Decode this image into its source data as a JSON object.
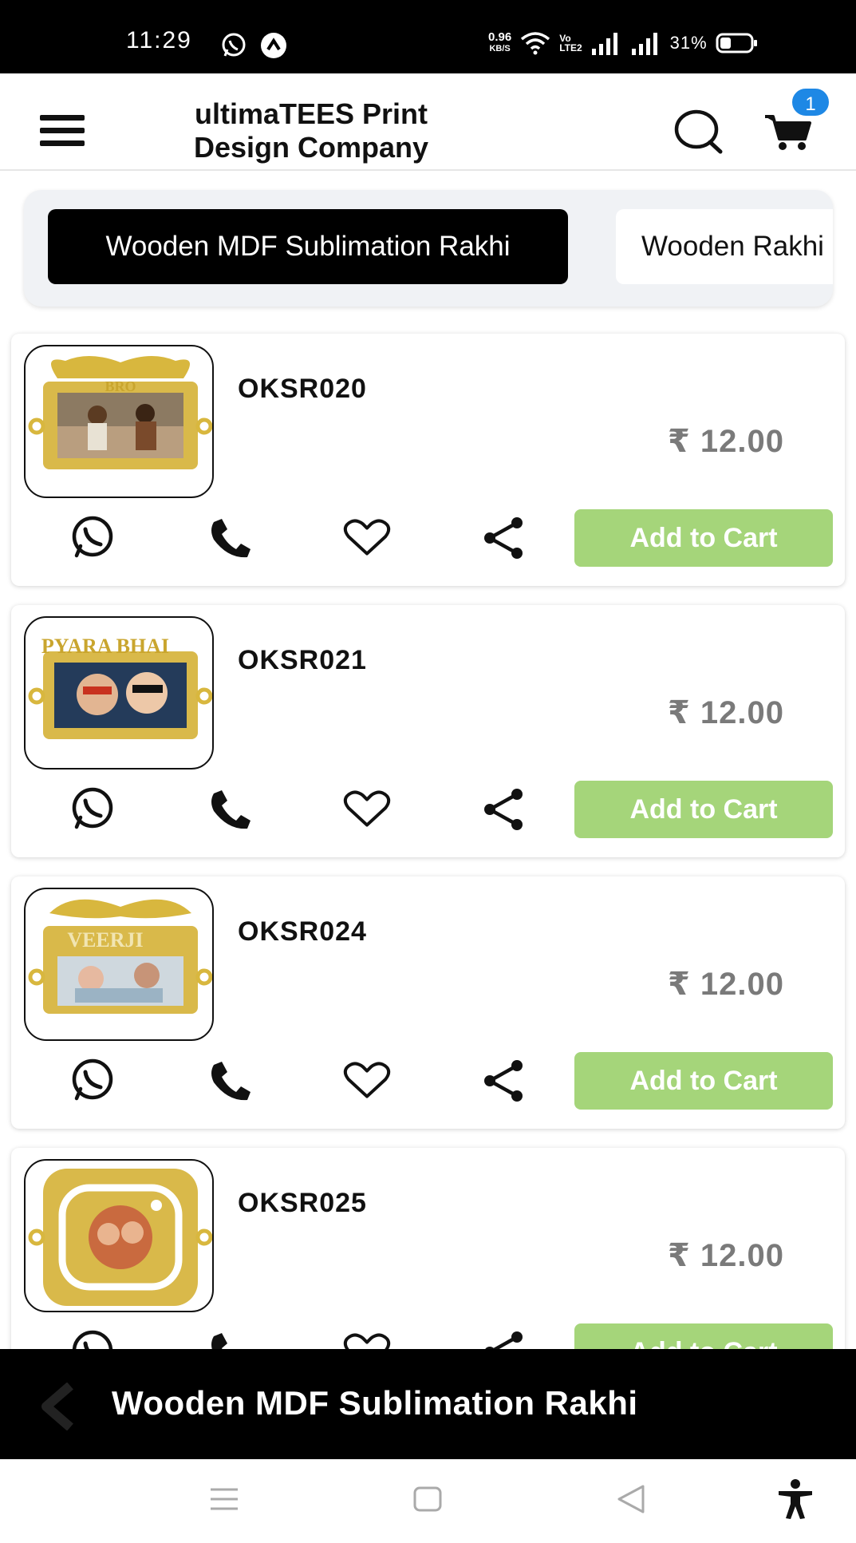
{
  "status_bar": {
    "time": "11:29",
    "net_speed": "0.96",
    "net_unit": "KB/S",
    "volte": "Vo",
    "lte": "LTE2",
    "battery": "31%"
  },
  "header": {
    "title_line1": "ultimaTEES Print",
    "title_line2": "Design Company",
    "cart_count": "1",
    "icons": [
      "menu-icon",
      "search-icon",
      "cart-icon"
    ]
  },
  "categories": {
    "active": "Wooden MDF Sublimation Rakhi",
    "next": "Wooden Rakhi"
  },
  "products": [
    {
      "sku": "OKSR020",
      "price": "₹ 12.00",
      "frame_text": "BRO",
      "add_label": "Add to Cart"
    },
    {
      "sku": "OKSR021",
      "price": "₹ 12.00",
      "frame_text": "PYARA BHAI",
      "add_label": "Add to Cart"
    },
    {
      "sku": "OKSR024",
      "price": "₹ 12.00",
      "frame_text": "VEERJI",
      "add_label": "Add to Cart"
    },
    {
      "sku": "OKSR025",
      "price": "₹ 12.00",
      "frame_text": "",
      "add_label": "Add to Cart"
    }
  ],
  "action_icons": [
    "whatsapp-icon",
    "phone-icon",
    "heart-icon",
    "share-icon"
  ],
  "bottom_bar": {
    "title": "Wooden MDF Sublimation Rakhi"
  },
  "colors": {
    "add_to_cart": "#a5d57a",
    "cart_badge": "#1e88e5",
    "active_tab": "#000000",
    "price": "#7a7a7a"
  }
}
